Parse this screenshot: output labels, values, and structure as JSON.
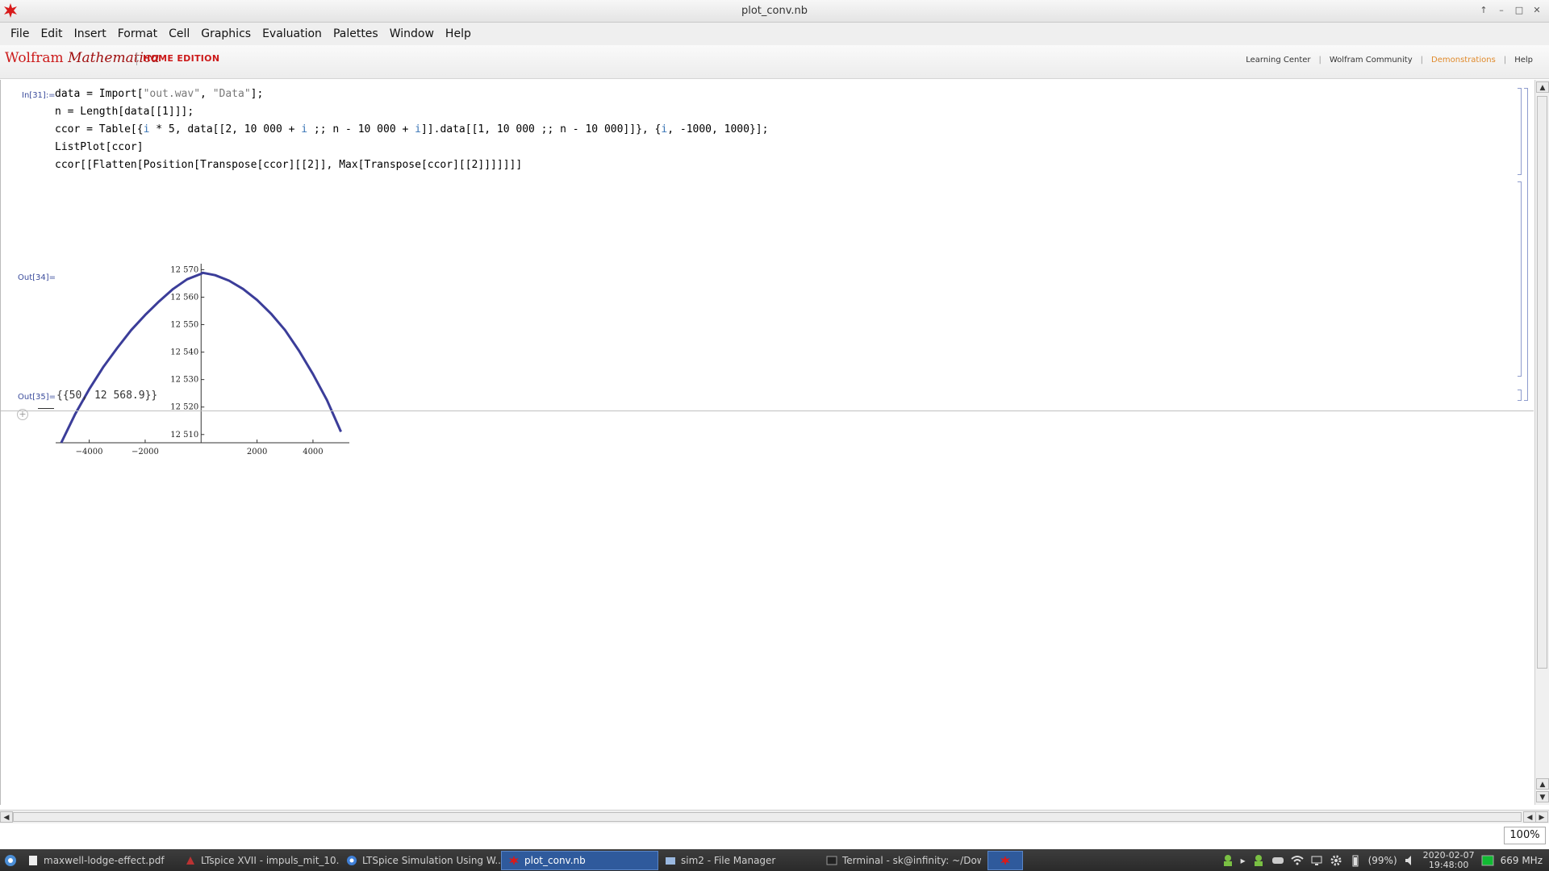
{
  "window": {
    "title": "plot_conv.nb"
  },
  "menu": [
    "File",
    "Edit",
    "Insert",
    "Format",
    "Cell",
    "Graphics",
    "Evaluation",
    "Palettes",
    "Window",
    "Help"
  ],
  "brand": {
    "name_plain": "Wolfram ",
    "name_italic": "Mathematica",
    "edition": "HOME EDITION",
    "links": [
      "Learning Center",
      "Wolfram Community",
      "Demonstrations",
      "Help"
    ]
  },
  "cells": {
    "in_label": "In[31]:=",
    "code_lines": {
      "l1_a": "data = Import[",
      "l1_s1": "\"out.wav\"",
      "l1_b": ", ",
      "l1_s2": "\"Data\"",
      "l1_c": "];",
      "l2": "n = Length[data[[1]]];",
      "l3_a": "ccor = Table[{",
      "l3_i1": "i",
      "l3_b": " * 5, data[[2, 10 000 + ",
      "l3_i2": "i",
      "l3_c": " ;; n - 10 000 + ",
      "l3_i3": "i",
      "l3_d": "]].data[[1, 10 000 ;; n - 10 000]]}, {",
      "l3_i4": "i",
      "l3_e": ", -1000, 1000}];",
      "l4": "ListPlot[ccor]",
      "l5": "ccor[[Flatten[Position[Transpose[ccor][[2]], Max[Transpose[ccor][[2]]]]]]]"
    },
    "out34_label": "Out[34]=",
    "out35_label": "Out[35]=",
    "out35_value": "{{50, 12 568.9}}"
  },
  "chart_data": {
    "type": "line",
    "x_ticks": [
      -4000,
      -2000,
      2000,
      4000
    ],
    "x_tick_labels": [
      "−4000",
      "−2000",
      "2000",
      "4000"
    ],
    "y_ticks": [
      12510,
      12520,
      12530,
      12540,
      12550,
      12560,
      12570
    ],
    "y_tick_labels": [
      "12 510",
      "12 520",
      "12 530",
      "12 540",
      "12 550",
      "12 560",
      "12 570"
    ],
    "xlim": [
      -5200,
      5300
    ],
    "ylim": [
      12507,
      12571
    ],
    "series": [
      {
        "color": "#3b3d99",
        "points": [
          [
            -5000,
            12507
          ],
          [
            -4500,
            12517.5
          ],
          [
            -4000,
            12526.5
          ],
          [
            -3500,
            12534.5
          ],
          [
            -3000,
            12541.5
          ],
          [
            -2500,
            12548
          ],
          [
            -2000,
            12553.5
          ],
          [
            -1500,
            12558.5
          ],
          [
            -1000,
            12563
          ],
          [
            -500,
            12566.5
          ],
          [
            0,
            12568.5
          ],
          [
            50,
            12568.9
          ],
          [
            500,
            12568
          ],
          [
            1000,
            12566
          ],
          [
            1500,
            12563
          ],
          [
            2000,
            12559
          ],
          [
            2500,
            12554
          ],
          [
            3000,
            12548
          ],
          [
            3500,
            12540.5
          ],
          [
            4000,
            12532
          ],
          [
            4500,
            12522.5
          ],
          [
            5000,
            12511
          ]
        ]
      }
    ]
  },
  "zoom": "100%",
  "taskbar": {
    "items": [
      {
        "label": "maxwell-lodge-effect.pdf",
        "active": false
      },
      {
        "label": "LTspice XVII - impuls_mit_10...",
        "active": false
      },
      {
        "label": "LTSpice Simulation Using W...",
        "active": false
      },
      {
        "label": "plot_conv.nb",
        "active": true
      },
      {
        "label": "sim2 - File Manager",
        "active": false
      },
      {
        "label": "Terminal - sk@infinity: ~/Dow...",
        "active": false
      }
    ],
    "battery": "(99%)",
    "date": "2020-02-07",
    "time": "19:48:00",
    "cpu": "669 MHz"
  }
}
